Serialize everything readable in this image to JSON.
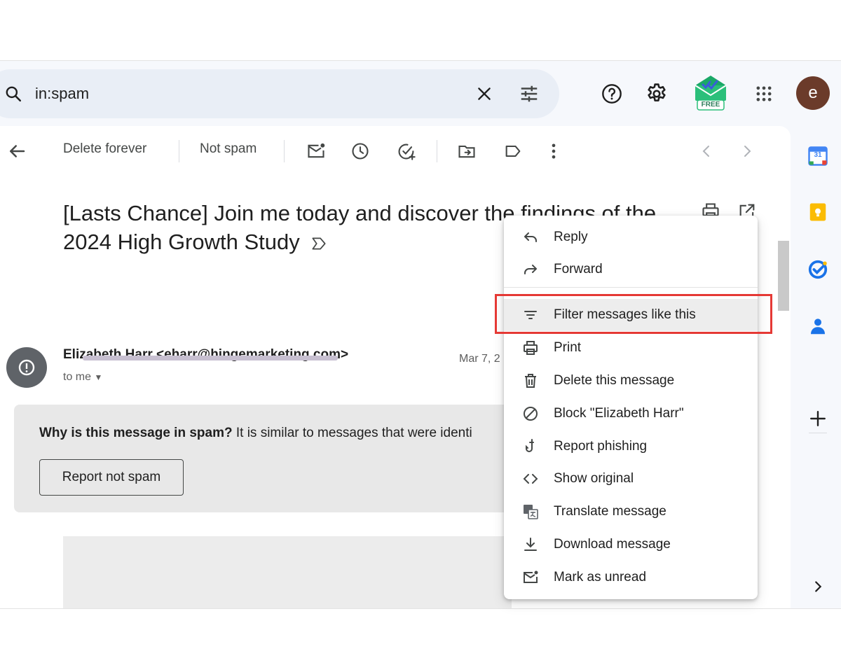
{
  "search": {
    "query": "in:spam"
  },
  "extension": {
    "badge": "FREE"
  },
  "user": {
    "avatar_letter": "e"
  },
  "toolbar": {
    "delete_forever": "Delete forever",
    "not_spam": "Not spam"
  },
  "email": {
    "subject": "[Lasts Chance] Join me today and discover the findings of the 2024 High Growth Study",
    "sender": "Elizabeth Harr <eharr@hingemarketing.com>",
    "to": "to me",
    "date": "Mar 7, 2"
  },
  "spam_notice": {
    "question": "Why is this message in spam?",
    "reason": " It is similar to messages that were identi",
    "button": "Report not spam"
  },
  "calendar": {
    "day": "31"
  },
  "menu": {
    "items": [
      {
        "label": "Reply",
        "icon": "reply-icon"
      },
      {
        "label": "Forward",
        "icon": "forward-icon"
      },
      {
        "label": "Filter messages like this",
        "icon": "filter-icon"
      },
      {
        "label": "Print",
        "icon": "print-icon"
      },
      {
        "label": "Delete this message",
        "icon": "trash-icon"
      },
      {
        "label": "Block \"Elizabeth Harr\"",
        "icon": "block-icon"
      },
      {
        "label": "Report phishing",
        "icon": "phishing-hook-icon"
      },
      {
        "label": "Show original",
        "icon": "code-icon"
      },
      {
        "label": "Translate message",
        "icon": "translate-icon"
      },
      {
        "label": "Download message",
        "icon": "download-icon"
      },
      {
        "label": "Mark as unread",
        "icon": "mark-unread-icon"
      }
    ]
  },
  "colors": {
    "highlight_box": "#e53935",
    "search_bg": "#e9eef6",
    "avatar_bg": "#6b3b2a"
  }
}
